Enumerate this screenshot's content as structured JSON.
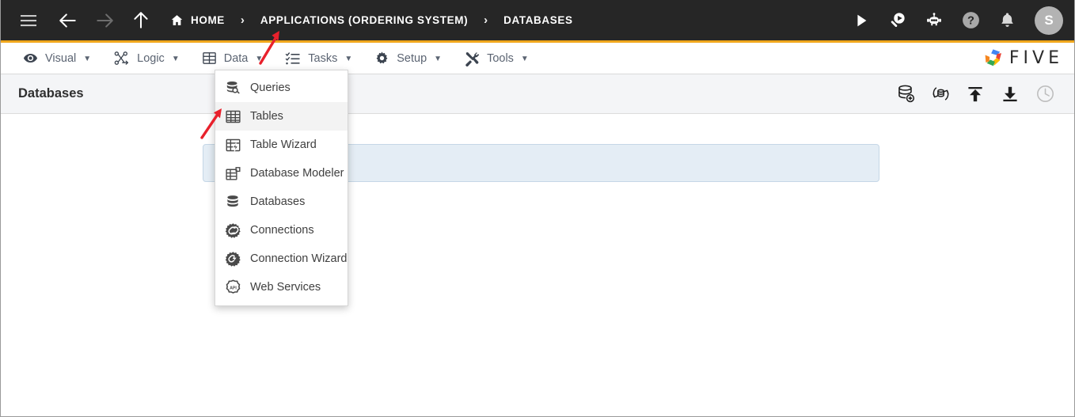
{
  "topbar": {
    "menu_icon": "hamburger-icon",
    "back_icon": "arrow-left-icon",
    "forward_icon": "arrow-right-icon",
    "up_icon": "arrow-up-icon",
    "home_icon": "home-icon",
    "breadcrumbs": [
      {
        "label": "HOME",
        "icon": "home-icon"
      },
      {
        "label": "APPLICATIONS (ORDERING SYSTEM)",
        "icon": ""
      },
      {
        "label": "DATABASES",
        "icon": ""
      }
    ],
    "separator": "›",
    "actions": [
      {
        "name": "run-button",
        "icon": "play-icon"
      },
      {
        "name": "debug-button",
        "icon": "search-play-icon"
      },
      {
        "name": "assistant-button",
        "icon": "robot-icon"
      },
      {
        "name": "help-button",
        "icon": "question-circle-icon"
      },
      {
        "name": "notifications-button",
        "icon": "bell-icon"
      }
    ],
    "avatar_initial": "S",
    "accent_color": "#f0a71c",
    "background_color": "#262626"
  },
  "menubar": {
    "items": [
      {
        "label": "Visual",
        "icon": "eye-icon",
        "caret": "▼"
      },
      {
        "label": "Logic",
        "icon": "logic-nodes-icon",
        "caret": "▼"
      },
      {
        "label": "Data",
        "icon": "grid-table-icon",
        "caret": "▼"
      },
      {
        "label": "Tasks",
        "icon": "checklist-icon",
        "caret": "▼"
      },
      {
        "label": "Setup",
        "icon": "gear-icon",
        "caret": "▼"
      },
      {
        "label": "Tools",
        "icon": "tools-icon",
        "caret": "▼"
      }
    ],
    "logo_text": "FIVE",
    "logo_icon": "five-pinwheel-logo"
  },
  "data_menu": {
    "items": [
      {
        "label": "Queries",
        "icon": "database-search-icon",
        "active": false
      },
      {
        "label": "Tables",
        "icon": "grid-table-icon",
        "active": true
      },
      {
        "label": "Table Wizard",
        "icon": "table-wizard-icon",
        "active": false
      },
      {
        "label": "Database Modeler",
        "icon": "database-modeler-icon",
        "active": false
      },
      {
        "label": "Databases",
        "icon": "database-icon",
        "active": false
      },
      {
        "label": "Connections",
        "icon": "connection-icon",
        "active": false
      },
      {
        "label": "Connection Wizard",
        "icon": "connection-wizard-icon",
        "active": false
      },
      {
        "label": "Web Services",
        "icon": "api-icon",
        "active": false
      }
    ]
  },
  "page": {
    "title": "Databases",
    "toolbar": [
      {
        "name": "add-database-button",
        "icon": "database-plus-icon",
        "disabled": false
      },
      {
        "name": "refresh-database-button",
        "icon": "database-sync-icon",
        "disabled": false
      },
      {
        "name": "upload-button",
        "icon": "upload-icon",
        "disabled": false
      },
      {
        "name": "download-button",
        "icon": "download-icon",
        "disabled": false
      },
      {
        "name": "history-button",
        "icon": "clock-icon",
        "disabled": true
      }
    ],
    "panel_background": "#e4edf5",
    "panel_border": "#c5d7e6"
  },
  "annotations": [
    {
      "name": "arrow-to-data-menu",
      "color": "#e8212c",
      "direction": "up-right"
    },
    {
      "name": "arrow-to-tables-item",
      "color": "#e8212c",
      "direction": "up-right"
    }
  ]
}
